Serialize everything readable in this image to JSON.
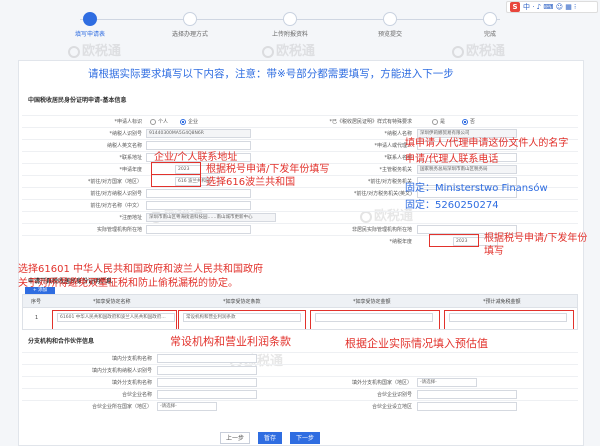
{
  "ime": {
    "logo": "S",
    "items": "中 · ♪ ⌨ ☺ ▦ ⁝"
  },
  "steps": [
    {
      "label": "填写申请表",
      "active": true
    },
    {
      "label": "选择办理方式",
      "active": false
    },
    {
      "label": "上传附报资料",
      "active": false
    },
    {
      "label": "预览提交",
      "active": false
    },
    {
      "label": "完成",
      "active": false
    }
  ],
  "watermark": "欧税通",
  "notice": "请根据实际要求填写以下内容，注意：带※号部分都需要填写，方能进入下一步",
  "section1_title": "中国税收居民身份证明申请-基本信息",
  "form": {
    "applicant_type_label": "*申请人标识",
    "opt_individual": "个人",
    "opt_enterprise": "企业",
    "tax_pay_label": "*已《税收居民证明》样式有特殊要求",
    "opt_yes": "是",
    "opt_no": "否",
    "taxpayer_id_label": "*纳税人识别号",
    "taxpayer_id_value": "91440300MA5G4Q8N6R",
    "taxpayer_name_label": "*纳税人名称",
    "taxpayer_name_value": "深圳伊莉娜贸易有限公司",
    "en_name_label": "纳税人英文名称",
    "agent_label": "*申请人或代理人",
    "contact_addr_label": "*联系地址",
    "contact_name_label": "*联系人名称",
    "year_label": "*申请年度",
    "year_value": "2023",
    "tax_auth_label": "*主管税务机关",
    "tax_auth_value": "国家税务总局深圳市南山区税务局",
    "country_label": "*前往/对方国家（地区）",
    "country_value": "616 波兰共和国",
    "foreign_tax_label": "*前往/对方税务机关",
    "foreign_tax_en_label": "*前往/对方税务机关(英文)",
    "foreign_tax_id_label": "前往/对方纳税人识别号",
    "foreign_name_label": "前往/对方名称（中文）",
    "reg_addr_label": "*注册地址",
    "reg_addr_value": "深圳市南山区粤海街道科技园……南山城市更新中心",
    "biz_addr_label": "非居民实际管理机构所在地",
    "actual_org_label": "实际管理机构所在地",
    "tax_year_label": "*纳税年度",
    "tax_year_value": "2023"
  },
  "section2_title": "申请开具税收居民身份证明信息",
  "add_label": "+ 添加",
  "table": {
    "headers": [
      "序号",
      "*如享受协定名称",
      "*如享受协定条款",
      "*如享受协定金额",
      "*预计减免税金额"
    ],
    "rows": [
      {
        "no": "1",
        "treaty": "61601 中华人民共和国政府和波兰人民共和国政府…",
        "clause": "常设机构和营业利润条款"
      }
    ]
  },
  "section3_title": "分支机构和合作伙伴信息",
  "branch": {
    "branch_name_label": "填内分支机构名称",
    "branch_id_label": "填内分支机构纳税人识别号",
    "branch_foreign_name_label": "填外分支机构名称",
    "branch_foreign_country_label": "填外分支机构国家（地区）",
    "partner_name_label": "合伙企业名称",
    "partner_id_label": "合伙企业识别号",
    "partner_country_label": "合伙企业所在国家（地区）",
    "partner_foreign_label": "合伙企业设立地区",
    "select_placeholder": "-请选择-"
  },
  "buttons": {
    "prev": "上一步",
    "save": "暂存",
    "next": "下一步"
  },
  "annotations": {
    "contact_address": "企业/个人联系地址",
    "tax_year_fill": "根据税号申请/下发年份填写",
    "choose_poland": "选择616波兰共和国",
    "applicant_name": "填申请人/代理申请这份文件人的名字",
    "applicant_phone": "申请/代理人联系电话",
    "fixed_ministry": "固定：Ministerstwo Finansów",
    "fixed_nip": "固定：5260250274",
    "tax_year_fill2_line1": "根据税号申请/下发年份",
    "tax_year_fill2_line2": "填写",
    "treaty_line1": "选择61601 中华人民共和国政府和波兰人民共和国政府",
    "treaty_line2": "关于对所得避免双重征税和防止偷税漏税的协定。",
    "clause_note": "常设机构和营业利润条款",
    "estimate_note": "根据企业实际情况填入预估值"
  }
}
